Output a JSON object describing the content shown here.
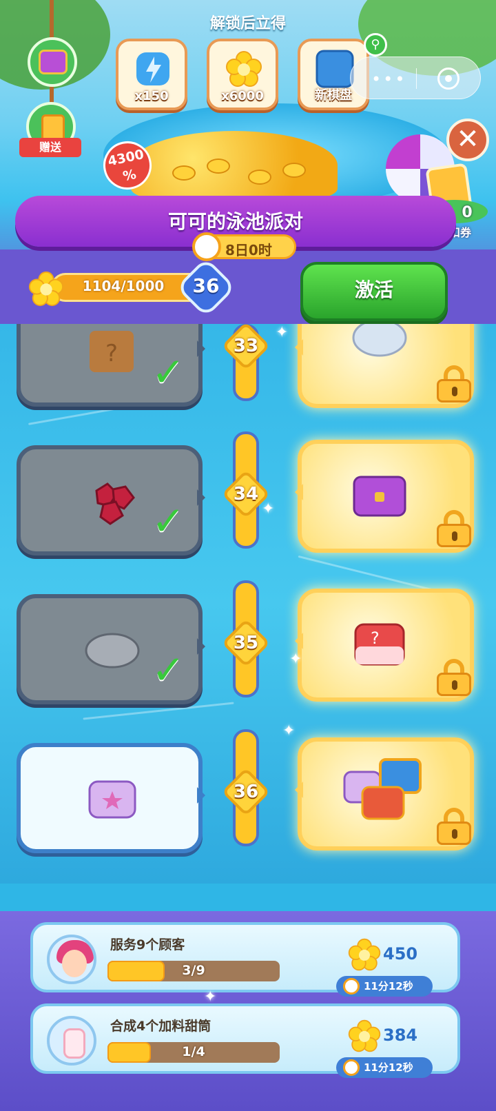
{
  "header": {
    "unlock_title": "解锁后立得",
    "rewards": [
      {
        "label": "x150",
        "icon": "energy-icon"
      },
      {
        "label": "x6000",
        "icon": "flower-icon"
      },
      {
        "label": "新棋盘",
        "icon": "board-icon"
      }
    ],
    "gift_label": "赠送",
    "discount_badge": "4300\n%",
    "coupon": {
      "count": "0",
      "label": "折扣券"
    }
  },
  "event": {
    "title": "可可的泳池派对",
    "timer": "8日0时"
  },
  "progress": {
    "text": "1104/1000",
    "level": "36",
    "fraction": 1.0
  },
  "activate_label": "激活",
  "rows": [
    {
      "level": "33",
      "free_item": "mystery-box-icon",
      "claimed": true,
      "paid_item": "shell-icon",
      "locked": true
    },
    {
      "level": "34",
      "free_item": "ruby-pile-icon",
      "claimed": true,
      "paid_item": "purple-chest-icon",
      "locked": true
    },
    {
      "level": "35",
      "free_item": "silver-shell-icon",
      "claimed": true,
      "paid_item": "red-mystery-box-icon",
      "locked": true
    },
    {
      "level": "36",
      "free_item": "purple-chest-icon",
      "claimed": false,
      "paid_item": "chest-bundle-icon",
      "locked": true
    }
  ],
  "tasks": [
    {
      "title": "服务9个顾客",
      "progress": "3/9",
      "fraction": 0.333,
      "reward": "450",
      "timer": "11分12秒",
      "avatar": "customer-avatar-icon"
    },
    {
      "title": "合成4个加料甜筒",
      "progress": "1/4",
      "fraction": 0.25,
      "reward": "384",
      "timer": "11分12秒",
      "avatar": "ice-cream-icon"
    }
  ],
  "colors": {
    "accent_purple": "#8a2fd0",
    "activate_green": "#2aa42c",
    "progress_orange": "#f5a41b"
  }
}
